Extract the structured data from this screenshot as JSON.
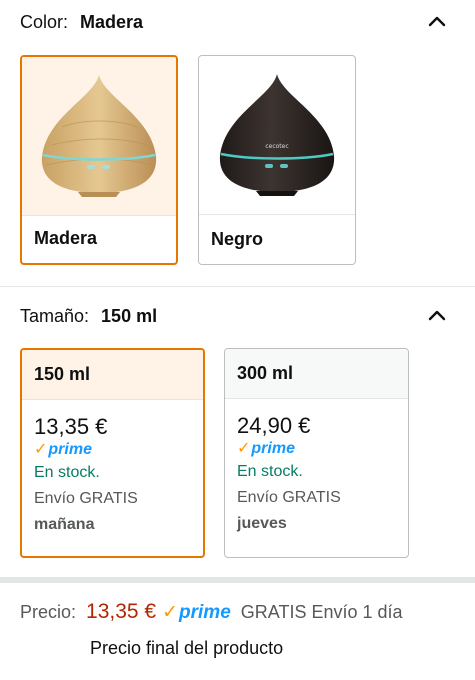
{
  "color_section": {
    "label": "Color:",
    "selected_value": "Madera",
    "options": [
      {
        "name": "Madera",
        "selected": true
      },
      {
        "name": "Negro",
        "selected": false
      }
    ]
  },
  "size_section": {
    "label": "Tamaño:",
    "selected_value": "150 ml",
    "options": [
      {
        "name": "150 ml",
        "price": "13,35 €",
        "prime": "prime",
        "stock": "En stock.",
        "shipping": "Envío GRATIS",
        "delivery_day": "mañana",
        "selected": true
      },
      {
        "name": "300 ml",
        "price": "24,90 €",
        "prime": "prime",
        "stock": "En stock.",
        "shipping": "Envío GRATIS",
        "delivery_day": "jueves",
        "selected": false
      }
    ]
  },
  "price_bar": {
    "label": "Precio:",
    "price": "13,35 €",
    "prime": "prime",
    "shipping": "GRATIS Envío 1 día",
    "final_note": "Precio final del producto"
  },
  "colors": {
    "selected_border": "#e77600",
    "selected_bg": "#fef3e6",
    "price_red": "#b12704",
    "stock_green": "#067d62",
    "prime_blue": "#1399ff",
    "prime_check": "#ff9900"
  },
  "icons": {
    "collapse": "chevron-up-icon",
    "prime_check": "check-icon"
  },
  "diffuser_colors": {
    "madera": "#d9b57a",
    "negro": "#2b2523"
  },
  "diffuser_brand": "cecotec"
}
